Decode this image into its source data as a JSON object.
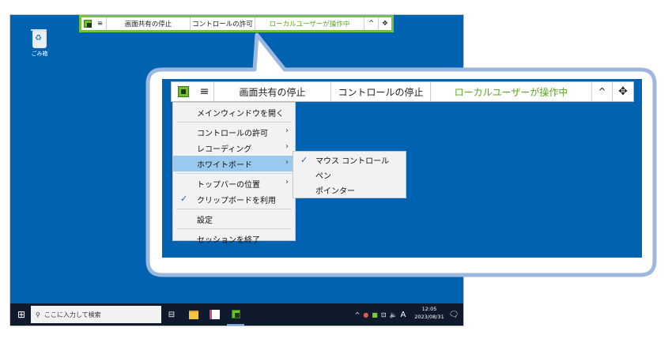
{
  "desktop": {
    "recycle_bin_label": "ごみ箱",
    "search_placeholder": "ここに入力して検索",
    "clock_time": "12:05",
    "clock_date": "2023/08/31",
    "ime_label": "A"
  },
  "toolbar": {
    "stop_sharing": "画面共有の停止",
    "allow_control": "コントロールの許可",
    "stop_control": "コントロールの停止",
    "local_user_status": "ローカルユーザーが操作中",
    "chevron": "^",
    "move": "✥",
    "menu": "≡"
  },
  "menu": {
    "open_main_window": "メインウィンドウを開く",
    "allow_control": "コントロールの許可",
    "recording": "レコーディング",
    "whiteboard": "ホワイトボード",
    "toolbar_position": "トップバーの位置",
    "use_clipboard": "クリップボードを利用",
    "settings": "設定",
    "end_session": "セッションを終了",
    "submenu": {
      "mouse_control": "マウス コントロール",
      "pen": "ペン",
      "pointer": "ポインター"
    }
  },
  "colors": {
    "desktop_blue": "#0063B1",
    "accent_green": "#77c23a",
    "callout_border": "#9db8de",
    "menu_selected": "#99c9ef",
    "taskbar": "#0f1b2d"
  }
}
